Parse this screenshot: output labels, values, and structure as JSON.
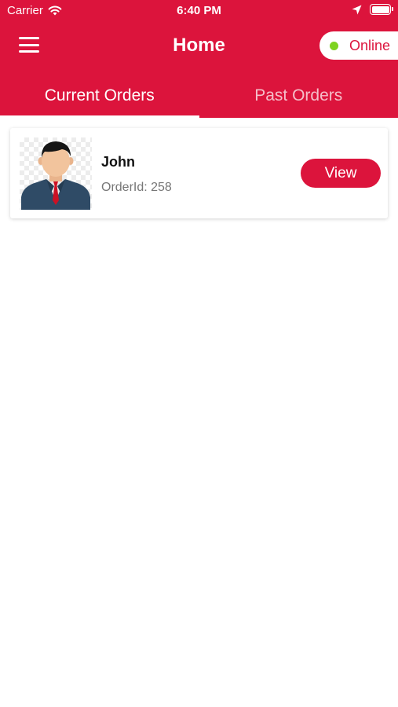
{
  "status_bar": {
    "carrier": "Carrier",
    "time": "6:40 PM",
    "icons": [
      "wifi-icon",
      "location-arrow-icon",
      "battery-icon"
    ]
  },
  "header": {
    "title": "Home",
    "menu_icon": "hamburger-menu-icon",
    "status_toggle": {
      "label": "Online",
      "dot_color": "#7ed321"
    }
  },
  "tabs": [
    {
      "label": "Current Orders",
      "active": true
    },
    {
      "label": "Past Orders",
      "active": false
    }
  ],
  "orders": [
    {
      "customer_name": "John",
      "order_id_text": "OrderId: 258",
      "avatar_icon": "businessman-avatar-icon",
      "action_label": "View"
    }
  ],
  "colors": {
    "brand": "#dc143c",
    "background": "#ffffff",
    "online": "#7ed321"
  }
}
